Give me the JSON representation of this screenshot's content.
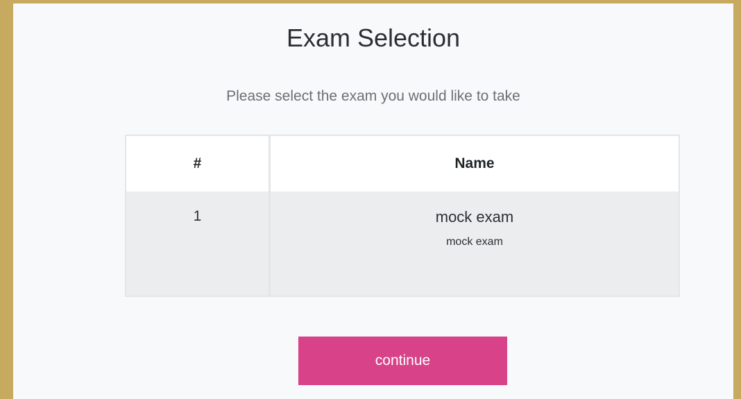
{
  "page": {
    "title": "Exam Selection",
    "subtitle": "Please select the exam you would like to take"
  },
  "table": {
    "headers": [
      "#",
      "Name"
    ],
    "rows": [
      {
        "number": "1",
        "name": "mock exam",
        "description": "mock exam"
      }
    ]
  },
  "actions": {
    "continue_label": "continue"
  },
  "colors": {
    "page_background": "#c7aa60",
    "panel_background": "#f8f9fb",
    "row_background": "#ecedee",
    "button_background": "#d84288",
    "button_text": "#ffffff"
  }
}
